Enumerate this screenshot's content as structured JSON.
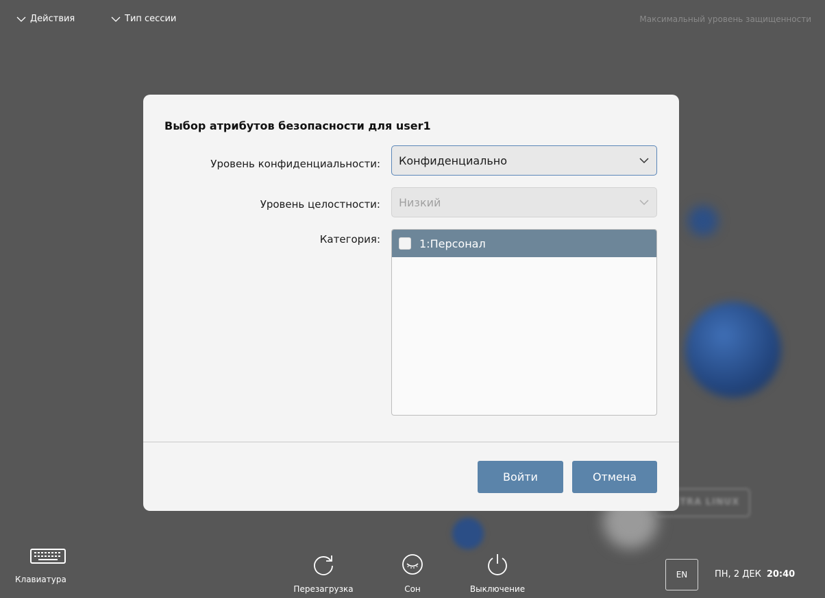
{
  "topbar": {
    "actions_label": "Действия",
    "session_type_label": "Тип сессии",
    "security_level_text": "Максимальный уровень защищенности"
  },
  "dialog": {
    "title": "Выбор атрибутов безопасности для user1",
    "confidentiality_label": "Уровень конфиденциальности:",
    "confidentiality_value": "Конфиденциально",
    "integrity_label": "Уровень целостности:",
    "integrity_value": "Низкий",
    "category_label": "Категория:",
    "categories": [
      {
        "label": "1:Персонал",
        "checked": false,
        "selected": true
      }
    ],
    "login_button": "Войти",
    "cancel_button": "Отмена"
  },
  "bottombar": {
    "keyboard_label": "Клавиатура",
    "reboot_label": "Перезагрузка",
    "sleep_label": "Сон",
    "shutdown_label": "Выключение",
    "language": "EN",
    "date": "ПН, 2 ДЕК",
    "time": "20:40"
  },
  "background_text": {
    "badge": "ASTRA LINUX"
  },
  "colors": {
    "background": "#575757",
    "dialog_bg": "#f4f4f4",
    "accent": "#5b84aa",
    "list_selected": "#6d8699"
  }
}
